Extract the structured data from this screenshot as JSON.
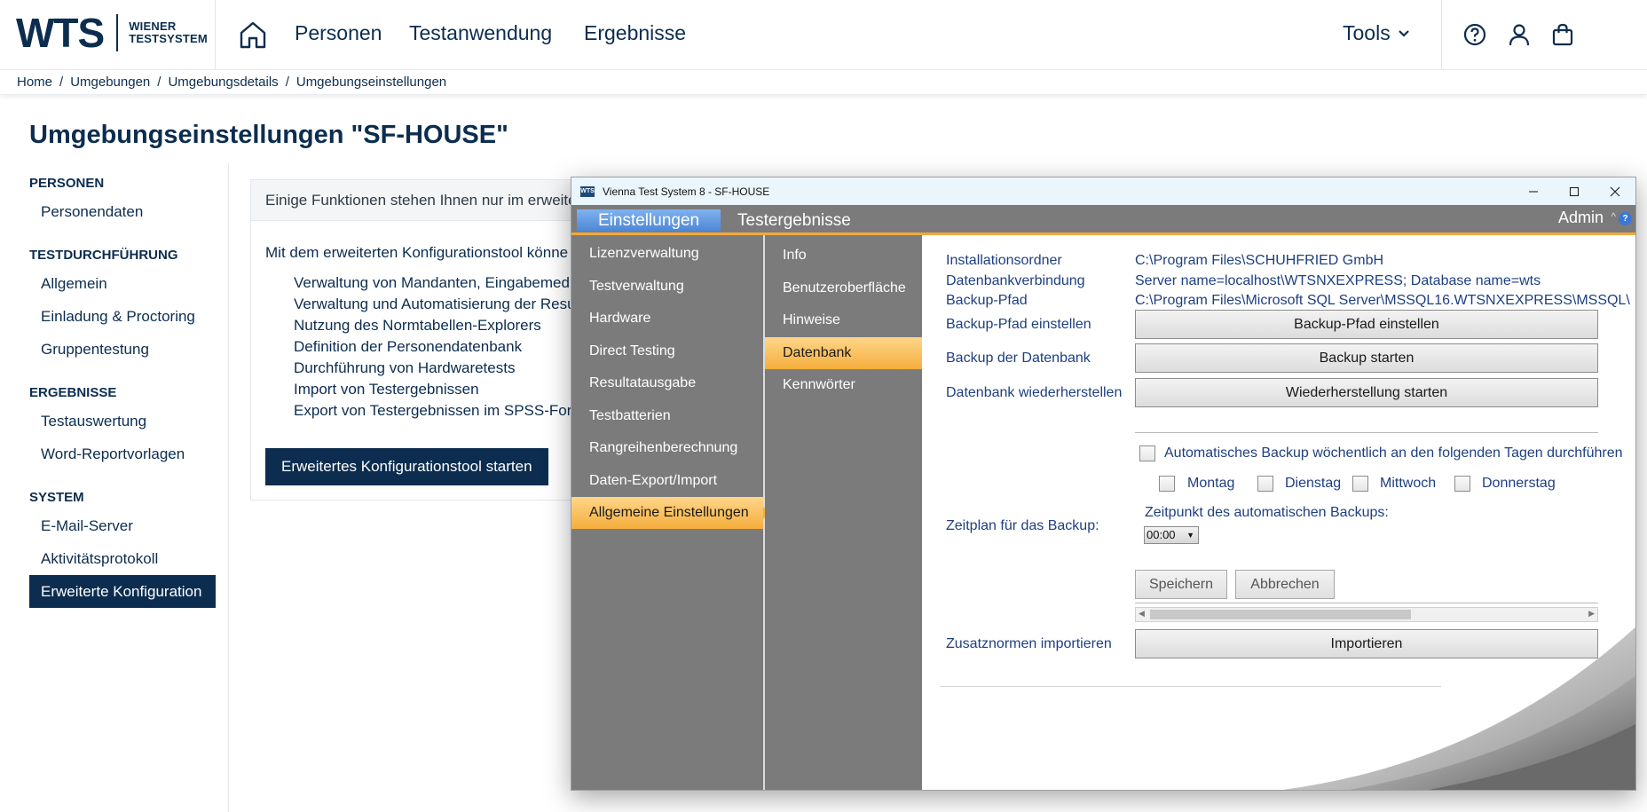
{
  "site": {
    "logo": {
      "mark": "WTS",
      "line1": "WIENER",
      "line2": "TESTSYSTEM"
    },
    "nav": [
      "Personen",
      "Testanwendung",
      "Ergebnisse"
    ],
    "tools_label": "Tools",
    "breadcrumb": [
      "Home",
      "Umgebungen",
      "Umgebungsdetails",
      "Umgebungseinstellungen"
    ],
    "page_title": "Umgebungseinstellungen \"SF-HOUSE\"",
    "side_nav": [
      {
        "heading": "PERSONEN",
        "items": [
          "Personendaten"
        ]
      },
      {
        "heading": "TESTDURCHFÜHRUNG",
        "items": [
          "Allgemein",
          "Einladung & Proctoring",
          "Gruppentestung"
        ]
      },
      {
        "heading": "ERGEBNISSE",
        "items": [
          "Testauswertung",
          "Word-Reportvorlagen"
        ]
      },
      {
        "heading": "SYSTEM",
        "items": [
          "E-Mail-Server",
          "Aktivitätsprotokoll",
          "Erweiterte Konfiguration"
        ]
      }
    ],
    "info_box": {
      "notice": "Einige Funktionen stehen Ihnen nur im erweite",
      "intro": "Mit dem erweiterten Konfigurationstool könne",
      "list": [
        "Verwaltung von Mandanten, Eingabemedi",
        "Verwaltung und Automatisierung der Resu",
        "Nutzung des Normtabellen-Explorers",
        "Definition der Personendatenbank",
        "Durchführung von Hardwaretests",
        "Import von Testergebnissen",
        "Export von Testergebnissen im SPSS-Form"
      ],
      "button": "Erweitertes Konfigurationstool starten"
    }
  },
  "app": {
    "window_title": "Vienna Test System 8 - SF-HOUSE",
    "icon_text": "WTS",
    "tabs": [
      "Einstellungen",
      "Testergebnisse"
    ],
    "user": "Admin",
    "main_menu": [
      "Lizenzverwaltung",
      "Testverwaltung",
      "Hardware",
      "Direct Testing",
      "Resultatausgabe",
      "Testbatterien",
      "Rangreihenberechnung",
      "Daten-Export/Import",
      "Allgemeine Einstellungen"
    ],
    "sub_menu": [
      "Info",
      "Benutzeroberfläche",
      "Hinweise",
      "Datenbank",
      "Kennwörter"
    ],
    "db": {
      "install_label": "Installationsordner",
      "install_value": "C:\\Program Files\\SCHUHFRIED GmbH",
      "conn_label": "Datenbankverbindung",
      "conn_value": "Server name=localhost\\WTSNXEXPRESS; Database name=wts",
      "backup_path_label": "Backup-Pfad",
      "backup_path_value": "C:\\Program Files\\Microsoft SQL Server\\MSSQL16.WTSNXEXPRESS\\MSSQL\\",
      "set_path_label": "Backup-Pfad einstellen",
      "set_path_button": "Backup-Pfad einstellen",
      "backup_label": "Backup der Datenbank",
      "backup_button": "Backup starten",
      "restore_label": "Datenbank wiederherstellen",
      "restore_button": "Wiederherstellung starten",
      "auto_backup": "Automatisches Backup wöchentlich an den folgenden Tagen durchführen",
      "days": [
        "Montag",
        "Dienstag",
        "Mittwoch",
        "Donnerstag"
      ],
      "schedule_label": "Zeitplan für das Backup:",
      "time_label": "Zeitpunkt des automatischen Backups:",
      "time_value": "00:00",
      "save": "Speichern",
      "cancel": "Abbrechen",
      "import_label": "Zusatznormen importieren",
      "import_button": "Importieren"
    }
  }
}
